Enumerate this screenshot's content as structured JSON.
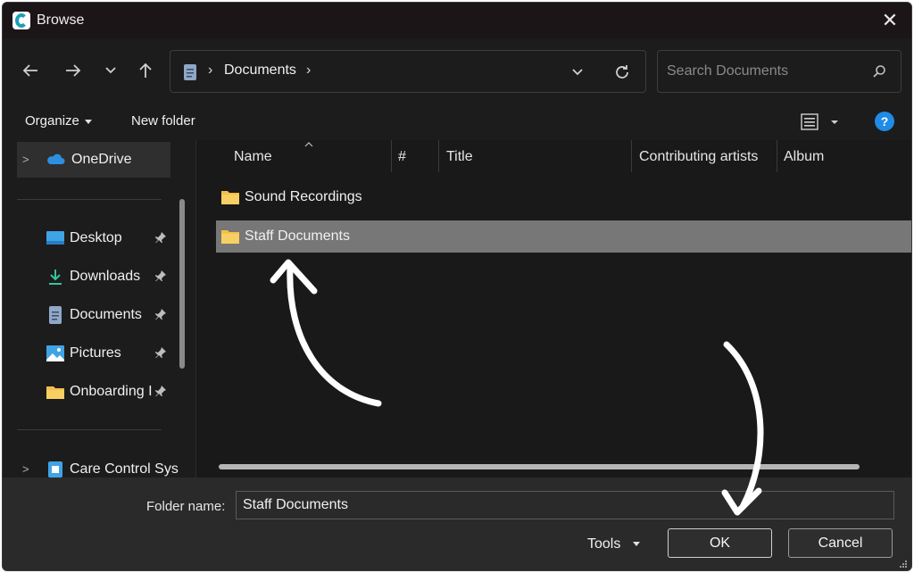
{
  "window": {
    "title": "Browse"
  },
  "address": {
    "crumb": "Documents"
  },
  "search": {
    "placeholder": "Search Documents"
  },
  "toolbar": {
    "organize": "Organize",
    "new_folder": "New folder"
  },
  "sidebar": {
    "onedrive": "OneDrive",
    "items": [
      {
        "label": "Desktop",
        "icon": "desktop-icon"
      },
      {
        "label": "Downloads",
        "icon": "download-icon"
      },
      {
        "label": "Documents",
        "icon": "documents-icon"
      },
      {
        "label": "Pictures",
        "icon": "pictures-icon"
      },
      {
        "label": "Onboarding I",
        "icon": "folder-icon"
      }
    ],
    "care_control": "Care Control Sys"
  },
  "columns": [
    "Name",
    "#",
    "Title",
    "Contributing artists",
    "Album"
  ],
  "files": [
    {
      "name": "Sound Recordings",
      "selected": false
    },
    {
      "name": "Staff Documents",
      "selected": true
    }
  ],
  "footer": {
    "folder_name_label": "Folder name:",
    "folder_name_value": "Staff Documents",
    "tools": "Tools",
    "ok": "OK",
    "cancel": "Cancel"
  },
  "colors": {
    "folder": "#f5c04a",
    "accent": "#1e8be6",
    "selected_row": "#777777"
  }
}
